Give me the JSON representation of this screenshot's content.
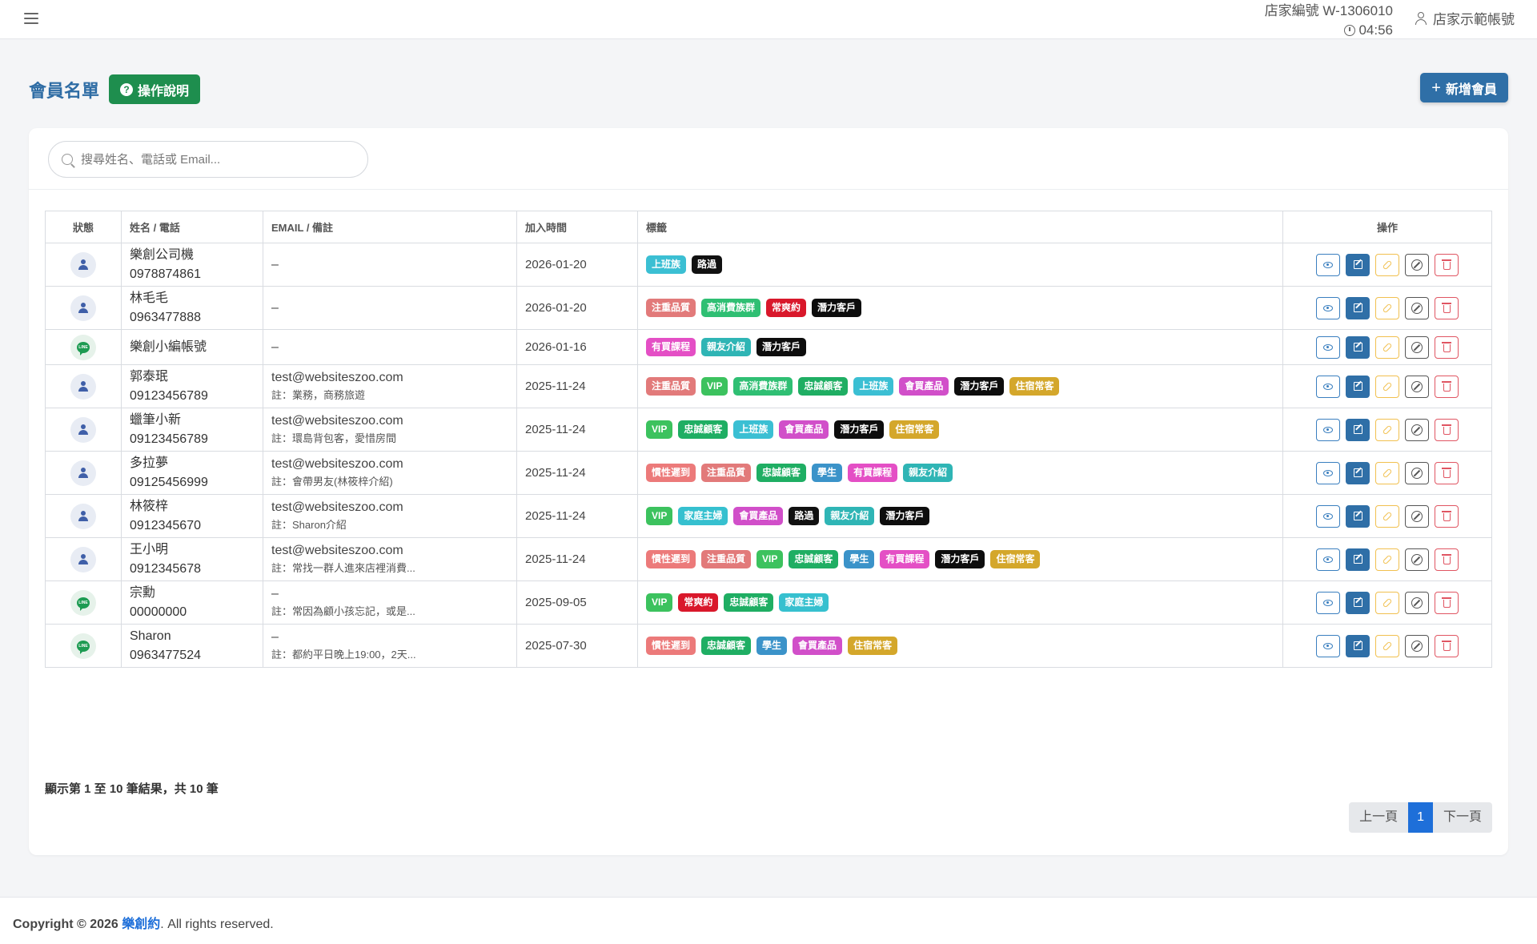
{
  "header": {
    "store_id": "店家編號 W-1306010",
    "clock": "04:56",
    "account_name": "店家示範帳號"
  },
  "page": {
    "title": "會員名單",
    "help_label": "操作說明",
    "add_label": "新增會員"
  },
  "search": {
    "placeholder": "搜尋姓名、電話或 Email..."
  },
  "table": {
    "columns": [
      "狀態",
      "姓名 / 電話",
      "EMAIL / 備註",
      "加入時間",
      "標籤",
      "操作"
    ],
    "rows": [
      {
        "status": "user",
        "name": "樂創公司機",
        "phone": "0978874861",
        "email": "–",
        "note": "",
        "date": "2026-01-20",
        "tags": [
          "上班族",
          "路過"
        ]
      },
      {
        "status": "user",
        "name": "林毛毛",
        "phone": "0963477888",
        "email": "–",
        "note": "",
        "date": "2026-01-20",
        "tags": [
          "注重品質",
          "高消費族群",
          "常爽約",
          "潛力客戶"
        ]
      },
      {
        "status": "line",
        "name": "樂創小編帳號",
        "phone": "",
        "email": "–",
        "note": "",
        "date": "2026-01-16",
        "tags": [
          "有買課程",
          "親友介紹",
          "潛力客戶"
        ]
      },
      {
        "status": "user",
        "name": "郭泰珉",
        "phone": "09123456789",
        "email": "test@websiteszoo.com",
        "note": "註：業務，商務旅遊",
        "date": "2025-11-24",
        "tags": [
          "注重品質",
          "VIP",
          "高消費族群",
          "忠誠顧客",
          "上班族",
          "會買產品",
          "潛力客戶",
          "住宿常客"
        ]
      },
      {
        "status": "user",
        "name": "蠟筆小新",
        "phone": "09123456789",
        "email": "test@websiteszoo.com",
        "note": "註：環島背包客，愛惜房間",
        "date": "2025-11-24",
        "tags": [
          "VIP",
          "忠誠顧客",
          "上班族",
          "會買產品",
          "潛力客戶",
          "住宿常客"
        ]
      },
      {
        "status": "user",
        "name": "多拉夢",
        "phone": "09125456999",
        "email": "test@websiteszoo.com",
        "note": "註：會帶男友(林筱梓介紹)",
        "date": "2025-11-24",
        "tags": [
          "慣性遲到",
          "注重品質",
          "忠誠顧客",
          "學生",
          "有買課程",
          "親友介紹"
        ]
      },
      {
        "status": "user",
        "name": "林筱梓",
        "phone": "0912345670",
        "email": "test@websiteszoo.com",
        "note": "註：Sharon介紹",
        "date": "2025-11-24",
        "tags": [
          "VIP",
          "家庭主婦",
          "會買產品",
          "路過",
          "親友介紹",
          "潛力客戶"
        ]
      },
      {
        "status": "user",
        "name": "王小明",
        "phone": "0912345678",
        "email": "test@websiteszoo.com",
        "note": "註：常找一群人進來店裡消費...",
        "date": "2025-11-24",
        "tags": [
          "慣性遲到",
          "注重品質",
          "VIP",
          "忠誠顧客",
          "學生",
          "有買課程",
          "潛力客戶",
          "住宿常客"
        ]
      },
      {
        "status": "line",
        "name": "宗勳",
        "phone": "00000000",
        "email": "–",
        "note": "註：常因為顧小孩忘記，或是...",
        "date": "2025-09-05",
        "tags": [
          "VIP",
          "常爽約",
          "忠誠顧客",
          "家庭主婦"
        ]
      },
      {
        "status": "line",
        "name": "Sharon",
        "phone": "0963477524",
        "email": "–",
        "note": "註：都約平日晚上19:00，2天...",
        "date": "2025-07-30",
        "tags": [
          "慣性遲到",
          "忠誠顧客",
          "學生",
          "會買產品",
          "住宿常客"
        ]
      }
    ]
  },
  "tag_colors": {
    "上班族": "#3bbfd3",
    "路過": "#111111",
    "注重品質": "#e27a7a",
    "高消費族群": "#2fbf73",
    "常爽約": "#d9182b",
    "潛力客戶": "#0d0d0d",
    "有買課程": "#e44fc5",
    "親友介紹": "#2fb5b5",
    "VIP": "#3cc25e",
    "忠誠顧客": "#1fae63",
    "會買產品": "#d14fc9",
    "住宿常客": "#d4a72b",
    "慣性遲到": "#ec7a7a",
    "學生": "#3b93c9",
    "家庭主婦": "#36c0cf"
  },
  "pagination": {
    "summary": "顯示第 1 至 10 筆結果，共 10 筆",
    "prev": "上一頁",
    "current": "1",
    "next": "下一頁"
  },
  "footer": {
    "copyright": "Copyright © 2026",
    "brand": "樂創約",
    "rights": ". All rights reserved."
  }
}
